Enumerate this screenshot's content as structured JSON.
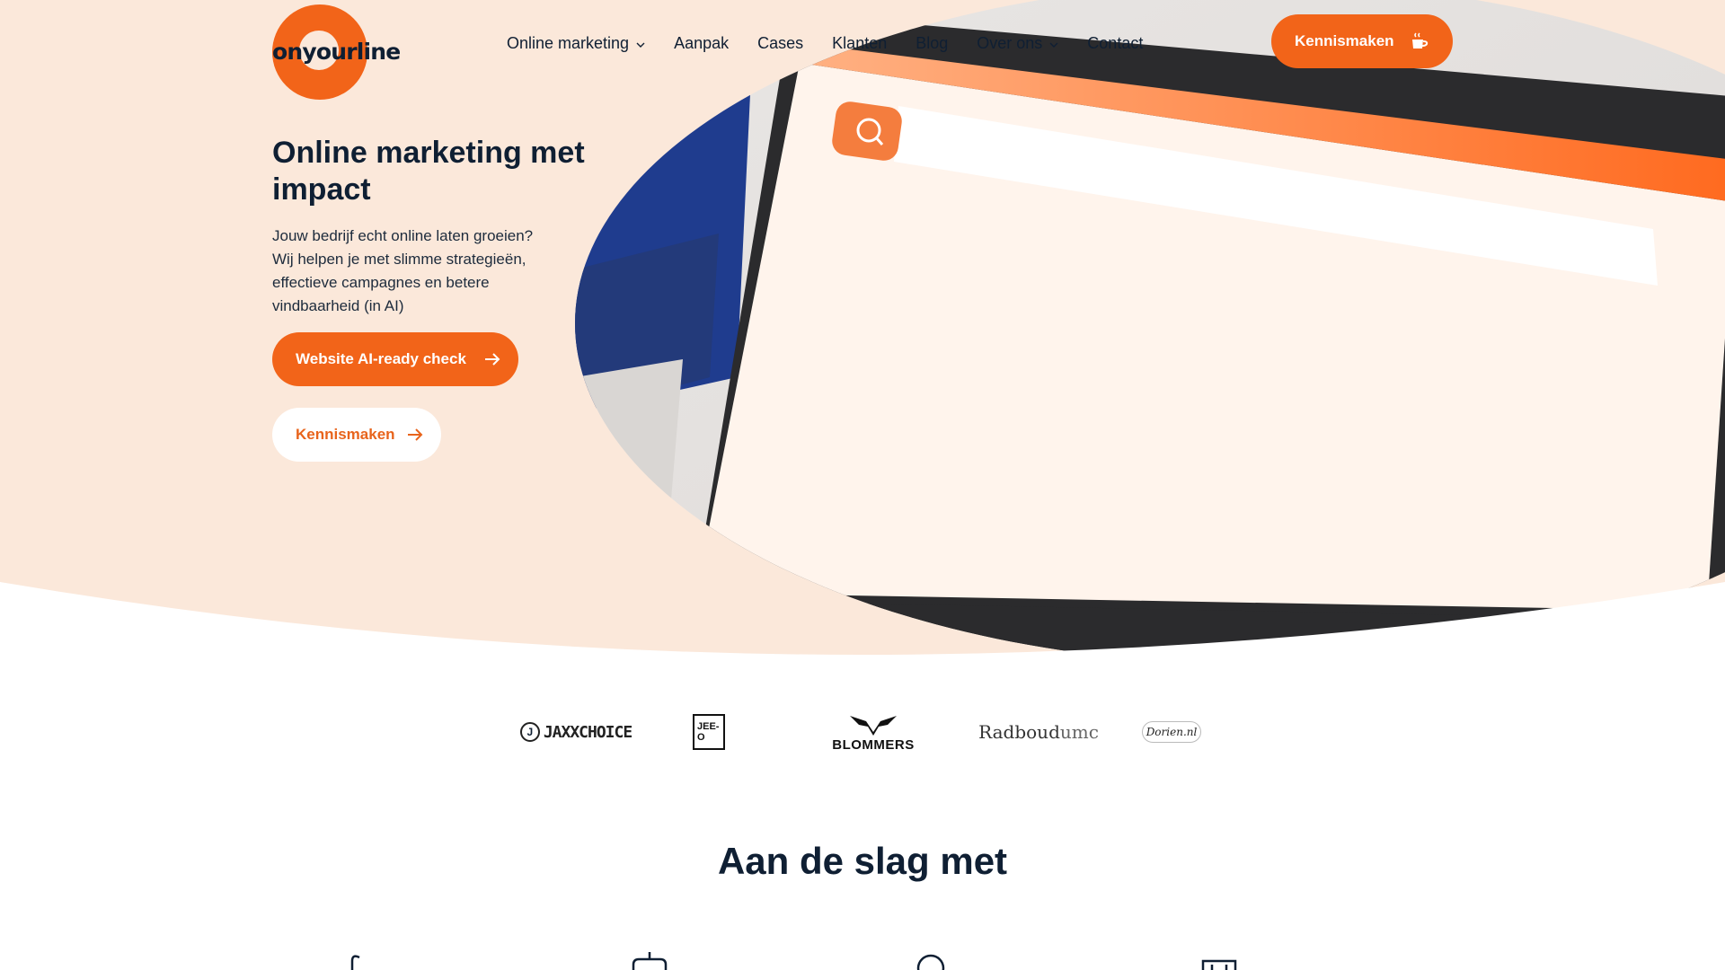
{
  "header": {
    "logo_text": "onyourline",
    "nav": [
      {
        "label": "Online marketing",
        "has_dropdown": true
      },
      {
        "label": "Aanpak",
        "has_dropdown": false
      },
      {
        "label": "Cases",
        "has_dropdown": false
      },
      {
        "label": "Klanten",
        "has_dropdown": false
      },
      {
        "label": "Blog",
        "has_dropdown": false
      },
      {
        "label": "Over ons",
        "has_dropdown": true
      },
      {
        "label": "Contact",
        "has_dropdown": false
      }
    ],
    "cta_label": "Kennismaken",
    "cta_icon": "coffee-cup-icon"
  },
  "hero": {
    "title": "Online marketing met impact",
    "text": "Jouw bedrijf echt online laten groeien? Wij helpen je met slimme strategieën, effectieve campagnes en betere vindbaarheid (in AI)",
    "primary_button": "Website AI-ready check",
    "secondary_button": "Kennismaken",
    "button_icon": "arrow-right-icon"
  },
  "clients": {
    "logos": [
      {
        "name": "JAXXCHOICE",
        "prefix": "J"
      },
      {
        "name": "JEE-O"
      },
      {
        "name": "BLOMMERS"
      },
      {
        "name_main": "Radboud",
        "name_sub": "umc"
      },
      {
        "name": "Dorien.nl"
      }
    ]
  },
  "section": {
    "title": "Aan de slag met"
  },
  "colors": {
    "accent": "#f26419",
    "hero_bg": "#fbe8da",
    "text_dark": "#0f1f33"
  }
}
